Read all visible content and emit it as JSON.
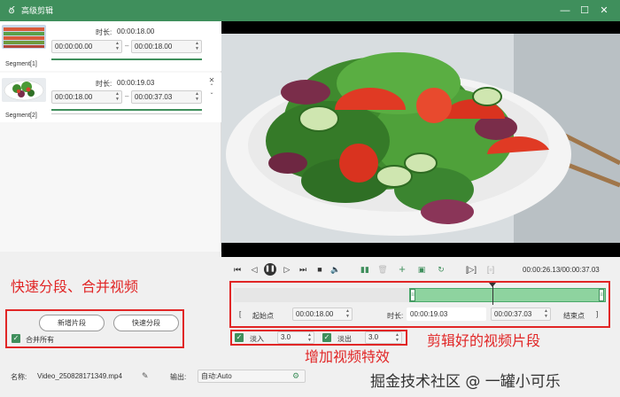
{
  "window": {
    "title": "高级剪辑"
  },
  "segments": [
    {
      "label": "Segment[1]",
      "duration_label": "时长:",
      "duration": "00:00:18.00",
      "start": "00:00:00.00",
      "end": "00:00:18.00"
    },
    {
      "label": "Segment[2]",
      "duration_label": "时长:",
      "duration": "00:00:19.03",
      "start": "00:00:18.00",
      "end": "00:00:37.03"
    }
  ],
  "player": {
    "timecode": "00:00:26.13/00:00:37.03"
  },
  "range": {
    "start_button": "起始点",
    "start": "00:00:18.00",
    "duration_label": "时长:",
    "duration": "00:00:19.03",
    "end": "00:00:37.03",
    "end_button": "结束点"
  },
  "effects": {
    "fade_in_label": "淡入",
    "fade_in_value": "3.0",
    "fade_out_label": "淡出",
    "fade_out_value": "3.0"
  },
  "segment_actions": {
    "add_label": "新增片段",
    "quick_split_label": "快速分段",
    "merge_all_label": "合并所有"
  },
  "bottom_bar": {
    "name_label": "名称:",
    "filename": "Video_250828171349.mp4",
    "output_label": "输出:",
    "output_value": "自动:Auto"
  },
  "annotations": {
    "quick_split": "快速分段、合并视频",
    "add_effects": "增加视频特效",
    "clipped_segment": "剪辑好的视频片段"
  },
  "watermark": "掘金技术社区 @ 一罐小可乐",
  "colors": {
    "accent": "#3f8f5c",
    "annotation_red": "#e12626"
  }
}
